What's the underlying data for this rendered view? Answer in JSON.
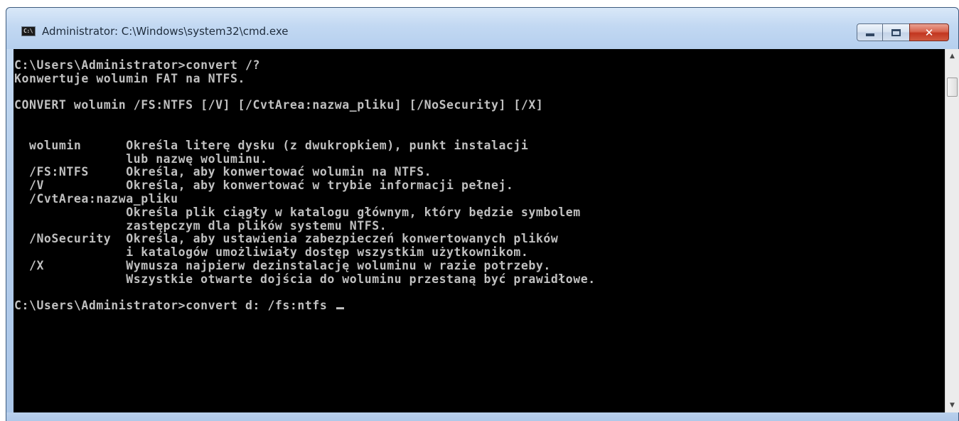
{
  "window": {
    "title": "Administrator: C:\\Windows\\system32\\cmd.exe",
    "icon": "cmd-icon",
    "icon_label": "C:\\",
    "controls": {
      "minimize": "minimize-icon",
      "maximize": "maximize-icon",
      "close": "close-icon",
      "close_glyph": "✕"
    }
  },
  "console": {
    "lines": [
      "C:\\Users\\Administrator>convert /?",
      "Konwertuje wolumin FAT na NTFS.",
      "",
      "CONVERT wolumin /FS:NTFS [/V] [/CvtArea:nazwa_pliku] [/NoSecurity] [/X]",
      "",
      "",
      "  wolumin      Określa literę dysku (z dwukropkiem), punkt instalacji",
      "               lub nazwę woluminu.",
      "  /FS:NTFS     Określa, aby konwertować wolumin na NTFS.",
      "  /V           Określa, aby konwertować w trybie informacji pełnej.",
      "  /CvtArea:nazwa_pliku",
      "               Określa plik ciągły w katalogu głównym, który będzie symbolem",
      "               zastępczym dla plików systemu NTFS.",
      "  /NoSecurity  Określa, aby ustawienia zabezpieczeń konwertowanych plików",
      "               i katalogów umożliwiały dostęp wszystkim użytkownikom.",
      "  /X           Wymusza najpierw dezinstalację woluminu w razie potrzeby.",
      "               Wszystkie otwarte dojścia do woluminu przestaną być prawidłowe.",
      "",
      "C:\\Users\\Administrator>convert d: /fs:ntfs "
    ],
    "foreground": "#c0c0c0",
    "background": "#000000"
  },
  "scrollbar": {
    "up_arrow": "▲",
    "down_arrow": "▼"
  }
}
